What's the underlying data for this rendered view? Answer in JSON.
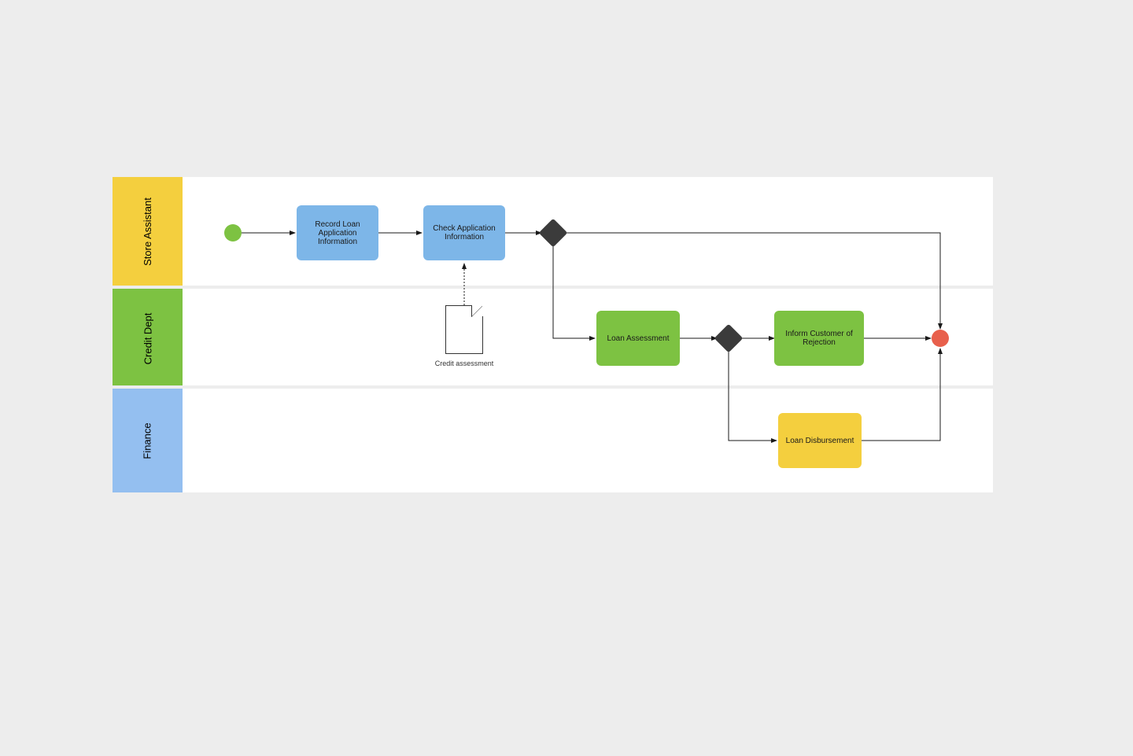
{
  "lanes": [
    {
      "name": "Store Assistant"
    },
    {
      "name": "Credit Dept"
    },
    {
      "name": "Finance"
    }
  ],
  "tasks": {
    "record": "Record Loan Application Information",
    "check": "Check Application Information",
    "assess": "Loan Assessment",
    "reject": "Inform Customer of Rejection",
    "disburse": "Loan Disbursement"
  },
  "dataObjects": {
    "creditAssessment": "Credit assessment"
  }
}
